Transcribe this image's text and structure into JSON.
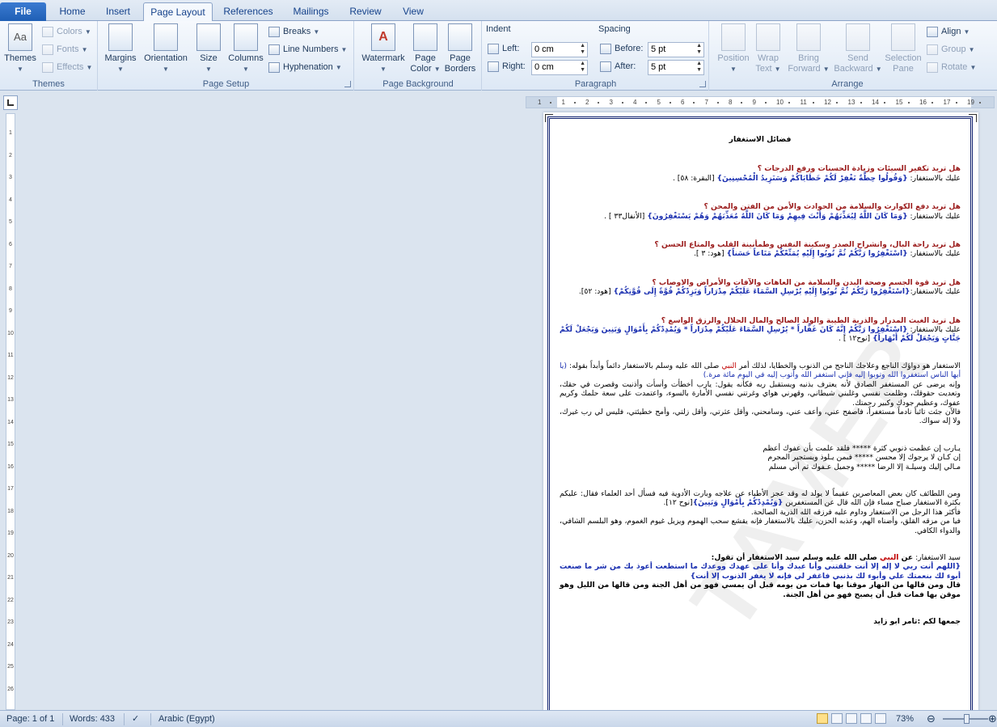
{
  "tabs": [
    "File",
    "Home",
    "Insert",
    "Page Layout",
    "References",
    "Mailings",
    "Review",
    "View"
  ],
  "active_tab": "Page Layout",
  "ribbon": {
    "themes": {
      "label": "Themes",
      "themes_btn": "Themes",
      "colors": "Colors",
      "fonts": "Fonts",
      "effects": "Effects"
    },
    "page_setup": {
      "label": "Page Setup",
      "margins": "Margins",
      "orientation": "Orientation",
      "size": "Size",
      "columns": "Columns",
      "breaks": "Breaks",
      "line_numbers": "Line Numbers",
      "hyphenation": "Hyphenation"
    },
    "page_background": {
      "label": "Page Background",
      "watermark": "Watermark",
      "page_color_1": "Page",
      "page_color_2": "Color",
      "page_borders_1": "Page",
      "page_borders_2": "Borders"
    },
    "paragraph": {
      "label": "Paragraph",
      "indent": "Indent",
      "left": "Left:",
      "right": "Right:",
      "left_val": "0 cm",
      "right_val": "0 cm",
      "spacing": "Spacing",
      "before": "Before:",
      "after": "After:",
      "before_val": "5 pt",
      "after_val": "5 pt"
    },
    "arrange": {
      "label": "Arrange",
      "position": "Position",
      "wrap_1": "Wrap",
      "wrap_2": "Text",
      "bring_1": "Bring",
      "bring_2": "Forward",
      "send_1": "Send",
      "send_2": "Backward",
      "selection_1": "Selection",
      "selection_2": "Pane",
      "align": "Align",
      "group": "Group",
      "rotate": "Rotate"
    }
  },
  "ruler": {
    "horizontal": [
      "1",
      "1",
      "2",
      "3",
      "4",
      "5",
      "6",
      "7",
      "8",
      "9",
      "10",
      "11",
      "12",
      "13",
      "14",
      "15",
      "16",
      "17",
      "19"
    ],
    "vertical": [
      "1",
      "2",
      "3",
      "4",
      "5",
      "6",
      "7",
      "8",
      "9",
      "10",
      "11",
      "12",
      "13",
      "14",
      "15",
      "16",
      "17",
      "18",
      "19",
      "20",
      "21",
      "22",
      "23",
      "24",
      "25",
      "26"
    ]
  },
  "document": {
    "title": "فضائل الاستغفار",
    "sections": [
      {
        "q": "هل تريد تكفير السيئات وزيادة الحسنات ورفع الدرجات ؟",
        "pre": "عليك بالاستغفار: ",
        "ayah": "{وَقُولُوا حِطَّةٌ نَغْفِرْ لَكُمْ خَطَايَاكُمْ وَسَنَزِيدُ الْمُحْسِنِينَ}",
        "ref": " [البقرة: ٥٨] ."
      },
      {
        "q": "هل تريد دفع الكوارث والسلامة من الحوادث والأمن من الفتن والمحن ؟",
        "pre": "عليك بالاستغفار: ",
        "ayah": "{وَمَا كَانَ اللَّهُ لِيُعَذِّبَهُمْ وَأَنْتَ فِيهِمْ وَمَا كَانَ اللَّهُ مُعَذِّبَهُمْ وَهُمْ يَسْتَغْفِرُونَ}",
        "ref": " [الأنفال٣٣ ] ."
      },
      {
        "q": "هل تريد راحة البال، وانشراح الصدر وسكينة النفس وطمأنينة القلب والمتاع الحسن ؟",
        "pre": "عليك بالاستغفار: ",
        "ayah": "{اسْتَغْفِرُوا رَبَّكُمْ ثُمَّ تُوبُوا إِلَيْهِ يُمَتِّعْكُمْ مَتَاعاً حَسَناً}",
        "ref": " [هود: ٣ ]."
      },
      {
        "q": "هل تريد قوة الجسم وصحة البدن والسلامة من العاهات والآفات والأمراض والاوصاب ؟",
        "pre": "عليك بالاستغفار:",
        "ayah": "{اسْتَغْفِرُوا رَبَّكُمْ ثُمَّ تُوبُوا إِلَيْهِ يُرْسِلِ السَّمَاءَ عَلَيْكُمْ مِدْرَاراً وَيَزِدْكُمْ قُوَّةً إِلَى قُوَّتِكُمْ}",
        "ref": " [هود: ٥٢]."
      },
      {
        "q": "هل تريد الغيث المدرار والذرية الطيبة والولد الصالح والمال الحلال والرزق الواسع ؟",
        "pre": "عليك بالاستغفار: ",
        "ayah": "{اسْتَغْفِرُوا رَبَّكُمْ إِنَّهُ كَانَ غَفَّاراً * يُرْسِلِ السَّمَاءَ عَلَيْكُمْ مِدْرَاراً * وَيُمْدِدْكُمْ بِأَمْوَالٍ وَبَنِينَ وَيَجْعَلْ لَكُمْ جَنَّاتٍ وَيَجْعَلْ لَكُمْ أَنْهَاراً}",
        "ref": " [نوح١٢ ] ."
      }
    ],
    "para1_a": "الاستغفار هو دواؤك الناجع وعلاجك الناجح من الذنوب والخطايا، لذلك أمر ",
    "nabi": "النبي",
    "para1_b": " صلى الله عليه وسلم بالاستغفار دائماً وأبداً بقوله: ",
    "para1_quote": "(يا أيها الناس استغفروا الله وتوبوا إليه فإني استغفر الله وأتوب إليه في اليوم مائة مرة.)",
    "para1_c": "وإنه يرضى عن المستغفر الصادق لأنه يعترف بذنبه ويستقبل ربه فكأنه يقول: يارب أخطأت وأسأت وأذنبت وقصرت في حقك، وتعديت حقوقك، وظلمت نفسي وغلبني شيطاني، وقهرني هواي وغرتني نفسي الأمارة بالسوء، واعتمدت على سعة حلمك وكريم عفوك، وعظيم جودك وكبير رحمتك.",
    "para1_d": "فالآن جئت تائباً نادماً مستغفراً، فاصفح عني، وأعف عني، وسامحني، وأقل عثرتي، وأقل زلتي، وأمح خطيئتي، فليس لي رب غيرك، ولا إله سواك.",
    "poem": [
      "يـارب إن عظمت ذنوبي كثرة ***** فلقد علمت بأن عفوك أعظم",
      "إن كـان لا يرجوك إلا محسن ***** فبمن يـلوذ ويستجير المجرم",
      "مـالي إليك وسيلـة إلا الرضا ***** وجميل عـفوك ثم أني مسلم"
    ],
    "para2_a": "ومن اللطائف كان بعض المعاصرين عقيماً لا يولد له وقد عجز الأطباء عن علاجه وبارت الأدوية فيه فسأل أحد العلماء فقال: عليكم بكثرة الاستغفار صباح مساء فإن الله قال عن المستغفرين ",
    "para2_ayah": "{وَيُمْدِدْكُمْ بِأَمْوَالٍ وَبَنِينَ}",
    "para2_b": "[نوح ١٢].",
    "para2_c": "فأكثر هذا الرجل من الاستغفار وداوم عليه فرزقه الله الذرية الصالحة.",
    "para2_d": "فيا من مزقه القلق، وأضناه الهم، وعذبه الحزن، عليك بالاستغفار فإنه يقشع سحب الهموم ويزيل غيوم الغموم، وهو البلسم الشافي، والدواء الكافي.",
    "sayyid_a": "سيد الاستغفار: ",
    "sayyid_b": "عن ",
    "sayyid_c": " صلى الله عليه وسلم سيد الاستغفار أن تقول:",
    "dua": "{اللهم أنت ربي لا إله إلا أنت خلقتني وأنا عبدك وأنا على عهدك ووعدك ما استطعت أعوذ بك من شر ما صنعت أبوء لك بنعمتك علي وأبوء لك بذنبي فاغفر لي فإنه لا يغفر الذنوب إلا أنت}",
    "dua_after": "قال ومن قالها من النهار موقنا بها فمات من يومه قبل أن يمسي فهو من أهل الجنة ومن قالها من الليل وهو موقن بها فمات قبل أن يصبح فهو من أهل الجنة.",
    "signature": "جمعها لكم :تامر ابو زايد"
  },
  "status": {
    "page": "Page: 1 of 1",
    "words": "Words: 433",
    "language": "Arabic (Egypt)",
    "zoom": "73%",
    "zoom_value": 73
  }
}
